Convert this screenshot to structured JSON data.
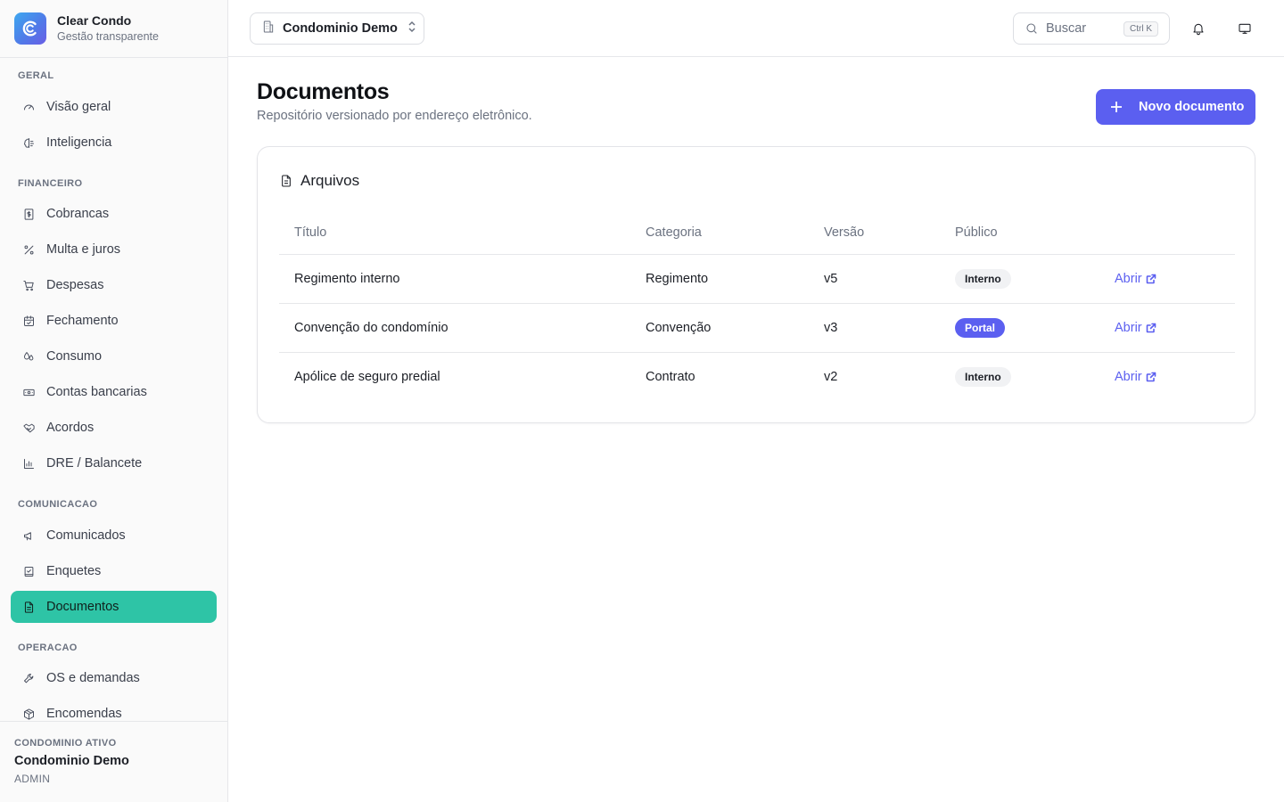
{
  "brand": {
    "name": "Clear Condo",
    "tagline": "Gestão transparente"
  },
  "sidebar": {
    "sections": [
      {
        "label": "GERAL",
        "items": [
          {
            "label": "Visão geral",
            "icon": "gauge-icon"
          },
          {
            "label": "Inteligencia",
            "icon": "brain-icon"
          }
        ]
      },
      {
        "label": "FINANCEIRO",
        "items": [
          {
            "label": "Cobrancas",
            "icon": "receipt-dollar-icon"
          },
          {
            "label": "Multa e juros",
            "icon": "percent-icon"
          },
          {
            "label": "Despesas",
            "icon": "cart-icon"
          },
          {
            "label": "Fechamento",
            "icon": "calendar-check-icon"
          },
          {
            "label": "Consumo",
            "icon": "droplets-icon"
          },
          {
            "label": "Contas bancarias",
            "icon": "banknote-icon"
          },
          {
            "label": "Acordos",
            "icon": "handshake-icon"
          },
          {
            "label": "DRE / Balancete",
            "icon": "bar-chart-icon"
          }
        ]
      },
      {
        "label": "COMUNICACAO",
        "items": [
          {
            "label": "Comunicados",
            "icon": "megaphone-icon"
          },
          {
            "label": "Enquetes",
            "icon": "vote-icon"
          },
          {
            "label": "Documentos",
            "icon": "file-text-icon",
            "active": true
          }
        ]
      },
      {
        "label": "OPERACAO",
        "items": [
          {
            "label": "OS e demandas",
            "icon": "wrench-icon"
          },
          {
            "label": "Encomendas",
            "icon": "package-icon"
          }
        ]
      }
    ],
    "footer": {
      "label": "CONDOMINIO ATIVO",
      "name": "Condominio Demo",
      "role": "ADMIN"
    }
  },
  "topbar": {
    "condo": "Condominio Demo",
    "search_placeholder": "Buscar",
    "search_shortcut": "Ctrl K"
  },
  "page": {
    "title": "Documentos",
    "subtitle": "Repositório versionado por endereço eletrônico.",
    "new_button": "Novo documento"
  },
  "card": {
    "title": "Arquivos",
    "columns": [
      "Título",
      "Categoria",
      "Versão",
      "Público"
    ],
    "open_label": "Abrir",
    "rows": [
      {
        "title": "Regimento interno",
        "category": "Regimento",
        "version": "v5",
        "visibility": "Interno"
      },
      {
        "title": "Convenção do condomínio",
        "category": "Convenção",
        "version": "v3",
        "visibility": "Portal"
      },
      {
        "title": "Apólice de seguro predial",
        "category": "Contrato",
        "version": "v2",
        "visibility": "Interno"
      }
    ]
  },
  "colors": {
    "accent": "#5b5ff0",
    "active_nav": "#2ec4a6"
  }
}
